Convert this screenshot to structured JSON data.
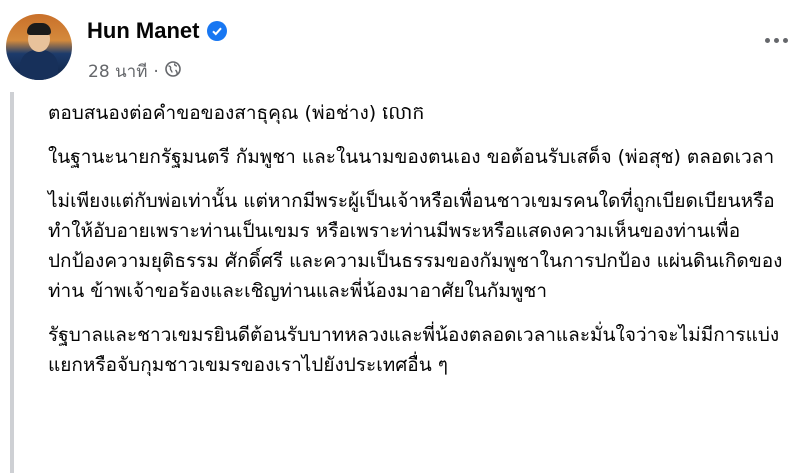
{
  "post": {
    "author_name": "Hun Manet",
    "time": "28 นาที",
    "separator": "·",
    "icons": {
      "verified": "verified-badge-icon",
      "audience": "globe-icon",
      "menu": "more-options-icon"
    },
    "colors": {
      "verified": "#1877f2",
      "meta_text": "#65676b",
      "quote_bar": "#ced0d4"
    },
    "paragraphs": [
      "ตอบสนองต่อคำขอของสาธุคุณ (พ่อช่าง) លោក",
      "ในฐานะนายกรัฐมนตรี กัมพูชา และในนามของตนเอง ขอต้อนรับเสด็จ (พ่อสุช) ตลอดเวลา",
      "ไม่เพียงแต่กับพ่อเท่านั้น แต่หากมีพระผู้เป็นเจ้าหรือเพื่อนชาวเขมรคนใดที่ถูกเบียดเบียนหรือทำให้อับอายเพราะท่านเป็นเขมร หรือเพราะท่านมีพระหรือแสดงความเห็นของท่านเพื่อปกป้องความยุติธรรม ศักดิ์ศรี และความเป็นธรรมของกัมพูชาในการปกป้อง แผ่นดินเกิดของท่าน ข้าพเจ้าขอร้องและเชิญท่านและพี่น้องมาอาศัยในกัมพูชา",
      "รัฐบาลและชาวเขมรยินดีต้อนรับบาทหลวงและพี่น้องตลอดเวลาและมั่นใจว่าจะไม่มีการแบ่งแยกหรือจับกุมชาวเขมรของเราไปยังประเทศอื่น ๆ"
    ]
  }
}
